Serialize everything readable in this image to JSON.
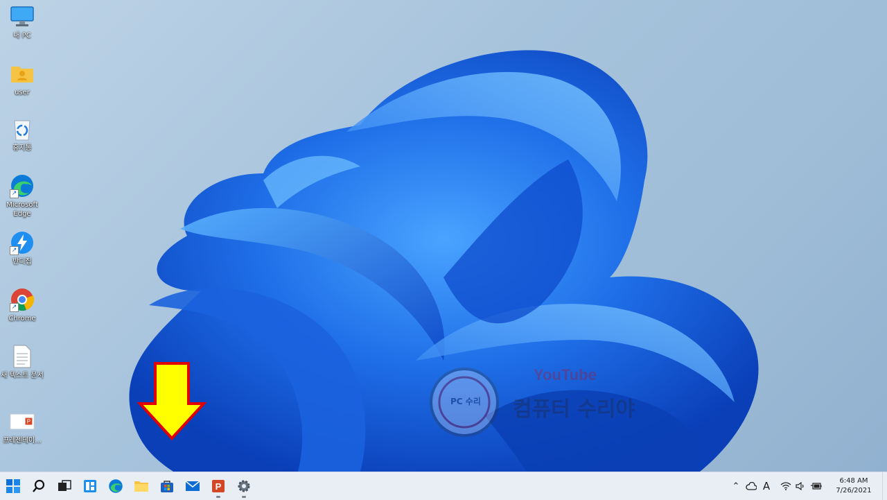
{
  "desktop": {
    "icons": [
      {
        "label": "내 PC",
        "icon": "monitor-icon"
      },
      {
        "label": "user",
        "icon": "user-folder-icon"
      },
      {
        "label": "휴지통",
        "icon": "recycle-bin-icon"
      },
      {
        "label": "Microsoft Edge",
        "icon": "edge-icon"
      },
      {
        "label": "반디집",
        "icon": "bandizip-icon"
      },
      {
        "label": "Chrome",
        "icon": "chrome-icon"
      },
      {
        "label": "새 텍스트 문서",
        "icon": "text-document-icon"
      },
      {
        "label": "프레젠테이...",
        "icon": "powerpoint-file-icon"
      }
    ]
  },
  "watermark": {
    "line1": "YouTube",
    "line2": "컴퓨터 수리야",
    "line3": "PC 수리"
  },
  "taskbar": {
    "apps": [
      {
        "name": "start",
        "icon": "windows-start-icon"
      },
      {
        "name": "search",
        "icon": "search-icon"
      },
      {
        "name": "task-view",
        "icon": "task-view-icon"
      },
      {
        "name": "widgets",
        "icon": "widgets-icon"
      },
      {
        "name": "edge",
        "icon": "edge-icon"
      },
      {
        "name": "file-explorer",
        "icon": "folder-icon"
      },
      {
        "name": "store",
        "icon": "store-icon"
      },
      {
        "name": "mail",
        "icon": "mail-icon"
      },
      {
        "name": "powerpoint",
        "icon": "powerpoint-icon"
      },
      {
        "name": "settings",
        "icon": "gear-icon"
      }
    ],
    "tray": {
      "ime": "A",
      "time": "6:48 AM",
      "date": "7/26/2021"
    }
  },
  "colors": {
    "accent": "#0a5bd7",
    "arrow_fill": "#ffff00",
    "arrow_stroke": "#e00000"
  }
}
